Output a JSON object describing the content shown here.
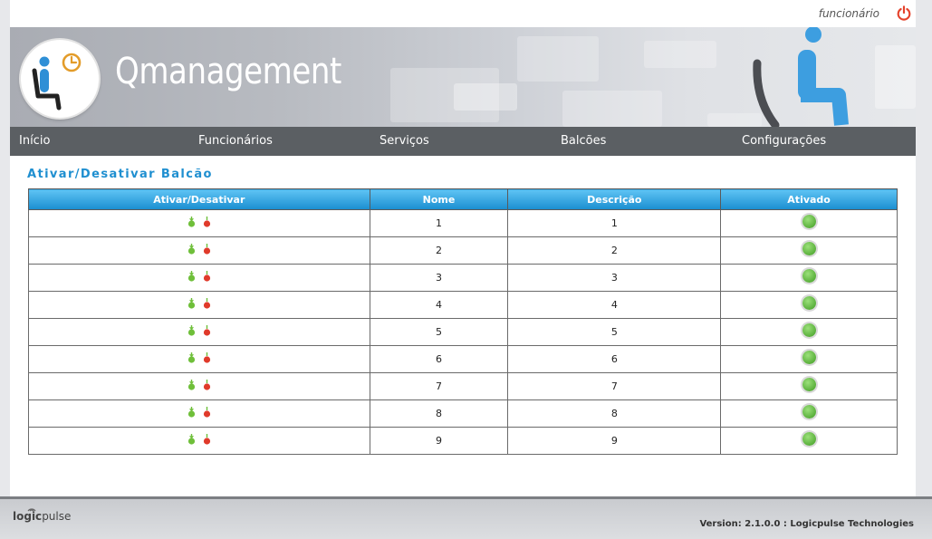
{
  "header": {
    "user_label": "funcionário"
  },
  "banner": {
    "app_title": "Qmanagement"
  },
  "nav": {
    "items": [
      "Início",
      "Funcionários",
      "Serviços",
      "Balcões",
      "Configurações"
    ]
  },
  "page": {
    "title": "Ativar/Desativar Balcão"
  },
  "table": {
    "columns": [
      "Ativar/Desativar",
      "Nome",
      "Descrição",
      "Ativado"
    ],
    "rows": [
      {
        "nome": "1",
        "descricao": "1",
        "ativado": true
      },
      {
        "nome": "2",
        "descricao": "2",
        "ativado": true
      },
      {
        "nome": "3",
        "descricao": "3",
        "ativado": true
      },
      {
        "nome": "4",
        "descricao": "4",
        "ativado": true
      },
      {
        "nome": "5",
        "descricao": "5",
        "ativado": true
      },
      {
        "nome": "6",
        "descricao": "6",
        "ativado": true
      },
      {
        "nome": "7",
        "descricao": "7",
        "ativado": true
      },
      {
        "nome": "8",
        "descricao": "8",
        "ativado": true
      },
      {
        "nome": "9",
        "descricao": "9",
        "ativado": true
      }
    ]
  },
  "footer": {
    "logo_logic": "logic",
    "logo_pulse": "pulse",
    "version": "Version: 2.1.0.0 : Logicpulse Technologies"
  },
  "colors": {
    "accent": "#1f8fd0",
    "nav_bg": "#5b5f63",
    "status_on": "#4caf2f",
    "deactivate": "#e03a2a",
    "activate": "#6fbf3a",
    "power": "#e5432c"
  },
  "icons": {
    "power": "power-icon",
    "activate": "activate-icon",
    "deactivate": "deactivate-icon",
    "status": "status-on-icon"
  }
}
